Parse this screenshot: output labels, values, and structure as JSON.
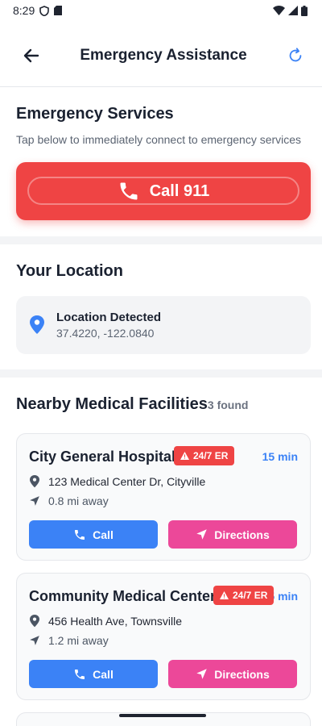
{
  "status_bar": {
    "time": "8:29"
  },
  "header": {
    "title": "Emergency Assistance"
  },
  "emergency": {
    "title": "Emergency Services",
    "subtitle": "Tap below to immediately connect to emergency services",
    "call_label": "Call 911"
  },
  "location": {
    "title": "Your Location",
    "status": "Location Detected",
    "coords": "37.4220, -122.0840"
  },
  "facilities": {
    "title": "Nearby Medical Facilities",
    "count": "3 found",
    "items": [
      {
        "name": "City General Hospital",
        "badge": "24/7 ER",
        "eta": "15 min",
        "address": "123 Medical Center Dr, Cityville",
        "distance": "0.8 mi away",
        "call_label": "Call",
        "directions_label": "Directions"
      },
      {
        "name": "Community Medical Center",
        "badge": "24/7 ER",
        "eta": "25 min",
        "address": "456 Health Ave, Townsville",
        "distance": "1.2 mi away",
        "call_label": "Call",
        "directions_label": "Directions"
      }
    ]
  },
  "colors": {
    "emergency_red": "#ef4444",
    "primary_blue": "#3b82f6",
    "directions_pink": "#ec4899"
  }
}
